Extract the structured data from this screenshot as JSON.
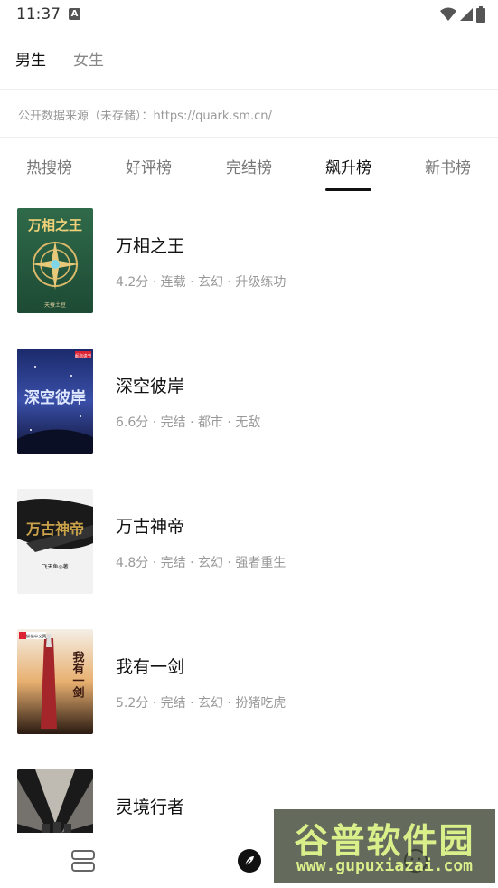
{
  "status_bar": {
    "time": "11:37",
    "notif_letter": "A"
  },
  "gender_tabs": [
    {
      "label": "男生",
      "active": true
    },
    {
      "label": "女生",
      "active": false
    }
  ],
  "source": {
    "text": "公开数据来源（未存储）：https://quark.sm.cn/"
  },
  "rank_tabs": [
    {
      "label": "热搜榜",
      "active": false
    },
    {
      "label": "好评榜",
      "active": false
    },
    {
      "label": "完结榜",
      "active": false
    },
    {
      "label": "飙升榜",
      "active": true
    },
    {
      "label": "新书榜",
      "active": false
    }
  ],
  "books": [
    {
      "title": "万相之王",
      "meta": "4.2分 · 连载 · 玄幻 · 升级练功",
      "cover_text": "万相之王",
      "cover_author": "天蚕土豆"
    },
    {
      "title": "深空彼岸",
      "meta": "6.6分 · 完结 · 都市 · 无敌",
      "cover_text": "深空彼岸",
      "cover_badge": "起点读书"
    },
    {
      "title": "万古神帝",
      "meta": "4.8分 · 完结 · 玄幻 · 强者重生",
      "cover_text": "万古神帝",
      "cover_author": "飞天鱼◎著"
    },
    {
      "title": "我有一剑",
      "meta": "5.2分 · 完结 · 玄幻 · 扮猪吃虎",
      "cover_text": "我有一剑",
      "cover_badge": "纵横中文网"
    },
    {
      "title": "灵境行者",
      "meta": "",
      "cover_text": ""
    }
  ],
  "bottom_nav": {
    "items": [
      "bookshelf-icon",
      "compass-icon",
      "profile-icon"
    ]
  },
  "watermark": {
    "title": "谷普软件园",
    "url": "www.gupuxiazai.com"
  },
  "colors": {
    "active_text": "#111111",
    "inactive_text": "#888888",
    "meta_text": "#999999",
    "underline": "#111111"
  }
}
